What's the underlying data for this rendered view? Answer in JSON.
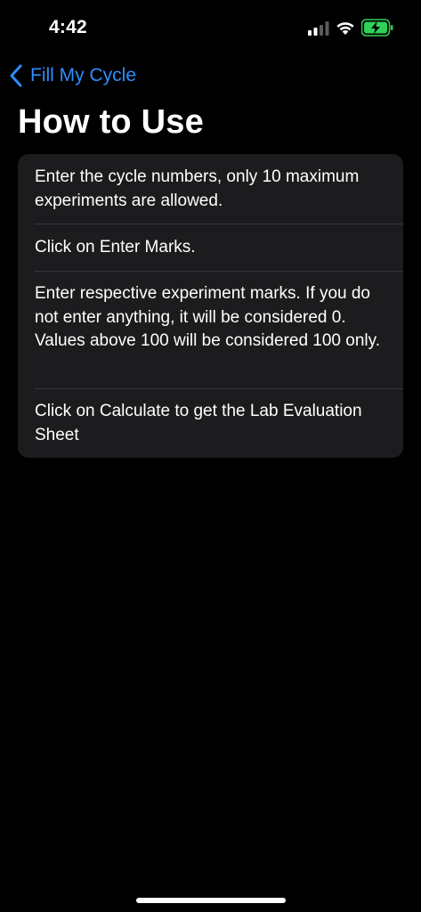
{
  "status_bar": {
    "time": "4:42",
    "icons": [
      "cellular-signal-icon",
      "wifi-icon",
      "battery-charging-icon"
    ],
    "battery_color": "#30d158"
  },
  "nav": {
    "back_label": "Fill My Cycle",
    "back_icon": "chevron-left-icon",
    "accent_color": "#2f8cff"
  },
  "page": {
    "title": "How to Use"
  },
  "instructions": [
    {
      "text": "Enter the cycle numbers, only 10 maximum experiments are allowed."
    },
    {
      "text": "Click on Enter Marks."
    },
    {
      "text": "Enter respective experiment marks. If you do not enter anything, it will be considered 0. Values above 100 will be considered 100 only."
    },
    {
      "text": "Click on Calculate to get the Lab Evaluation Sheet"
    }
  ]
}
